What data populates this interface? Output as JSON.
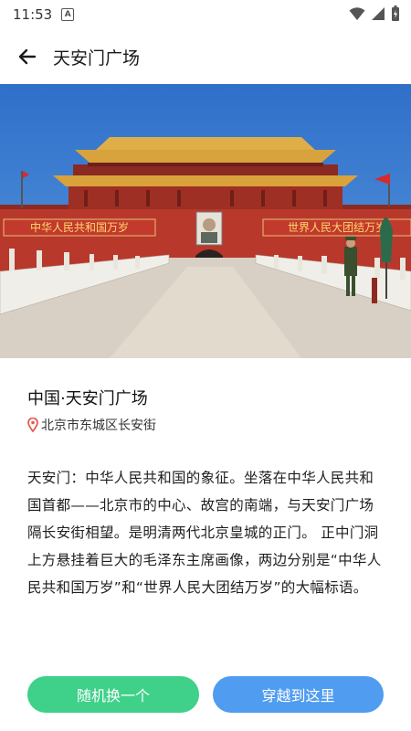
{
  "status_bar": {
    "time": "11:53",
    "notification_badge": "A"
  },
  "header": {
    "title": "天安门广场"
  },
  "place": {
    "title": "中国·天安门广场",
    "location": "北京市东城区长安街",
    "description": "天安门：中华人民共和国的象征。坐落在中华人民共和国首都——北京市的中心、故宫的南端，与天安门广场隔长安街相望。是明清两代北京皇城的正门。 正中门洞上方悬挂着巨大的毛泽东主席画像，两边分别是“中华人民共和国万岁”和“世界人民大团结万岁”的大幅标语。"
  },
  "hero": {
    "banner_left": "中华人民共和国万岁",
    "banner_right": "世界人民大团结万岁"
  },
  "actions": {
    "random_label": "随机换一个",
    "travel_label": "穿越到这里"
  },
  "colors": {
    "random_button": "#3fd08a",
    "travel_button": "#4f9cf0",
    "location_pin": "#e85a4f"
  }
}
